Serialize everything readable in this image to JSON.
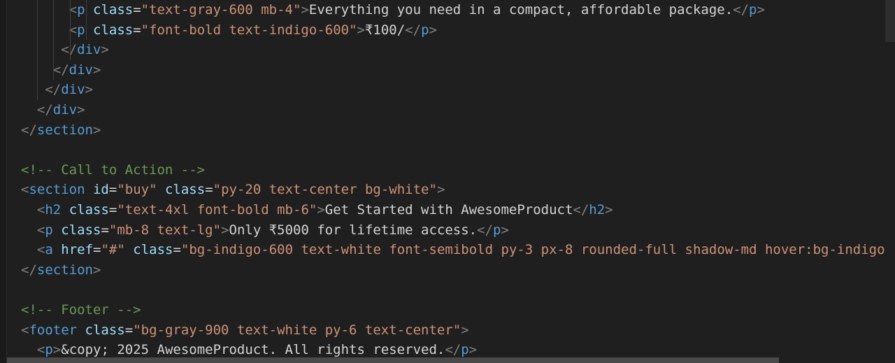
{
  "editor": {
    "theme_background": "#1f1f1f",
    "colors": {
      "punctuation": "#808080",
      "tag": "#569cd6",
      "attribute": "#9cdcfe",
      "string": "#ce9178",
      "text": "#d4d4d4",
      "comment": "#6a9955"
    },
    "lines": [
      {
        "guides": 4,
        "tokens": [
          {
            "t": "p",
            "v": "      "
          },
          {
            "t": "p",
            "v": "<"
          },
          {
            "t": "t",
            "v": "p"
          },
          {
            "t": "x",
            "v": " "
          },
          {
            "t": "a",
            "v": "class"
          },
          {
            "t": "x",
            "v": "="
          },
          {
            "t": "s",
            "v": "\"text-gray-600 mb-4\""
          },
          {
            "t": "p",
            "v": ">"
          },
          {
            "t": "x",
            "v": "Everything you need in a compact, affordable package."
          },
          {
            "t": "p",
            "v": "</"
          },
          {
            "t": "t",
            "v": "p"
          },
          {
            "t": "p",
            "v": ">"
          }
        ]
      },
      {
        "guides": 4,
        "tokens": [
          {
            "t": "p",
            "v": "      "
          },
          {
            "t": "p",
            "v": "<"
          },
          {
            "t": "t",
            "v": "p"
          },
          {
            "t": "x",
            "v": " "
          },
          {
            "t": "a",
            "v": "class"
          },
          {
            "t": "x",
            "v": "="
          },
          {
            "t": "s",
            "v": "\"font-bold text-indigo-600\""
          },
          {
            "t": "p",
            "v": ">"
          },
          {
            "t": "x",
            "v": "₹100/"
          },
          {
            "t": "p",
            "v": "</"
          },
          {
            "t": "t",
            "v": "p"
          },
          {
            "t": "p",
            "v": ">"
          }
        ]
      },
      {
        "guides": 3,
        "tokens": [
          {
            "t": "p",
            "v": "     "
          },
          {
            "t": "p",
            "v": "</"
          },
          {
            "t": "t",
            "v": "div"
          },
          {
            "t": "p",
            "v": ">"
          }
        ]
      },
      {
        "guides": 2,
        "tokens": [
          {
            "t": "p",
            "v": "    "
          },
          {
            "t": "p",
            "v": "</"
          },
          {
            "t": "t",
            "v": "div"
          },
          {
            "t": "p",
            "v": ">"
          }
        ]
      },
      {
        "guides": 1,
        "tokens": [
          {
            "t": "p",
            "v": "   "
          },
          {
            "t": "p",
            "v": "</"
          },
          {
            "t": "t",
            "v": "div"
          },
          {
            "t": "p",
            "v": ">"
          }
        ]
      },
      {
        "guides": 0,
        "tokens": [
          {
            "t": "p",
            "v": "  "
          },
          {
            "t": "p",
            "v": "</"
          },
          {
            "t": "t",
            "v": "div"
          },
          {
            "t": "p",
            "v": ">"
          }
        ]
      },
      {
        "guides": 0,
        "tokens": [
          {
            "t": "p",
            "v": "</"
          },
          {
            "t": "t",
            "v": "section"
          },
          {
            "t": "p",
            "v": ">"
          }
        ]
      },
      {
        "guides": 0,
        "tokens": []
      },
      {
        "guides": 0,
        "tokens": [
          {
            "t": "c",
            "v": "<!-- Call to Action -->"
          }
        ]
      },
      {
        "guides": 0,
        "tokens": [
          {
            "t": "p",
            "v": "<"
          },
          {
            "t": "t",
            "v": "section"
          },
          {
            "t": "x",
            "v": " "
          },
          {
            "t": "a",
            "v": "id"
          },
          {
            "t": "x",
            "v": "="
          },
          {
            "t": "s",
            "v": "\"buy\""
          },
          {
            "t": "x",
            "v": " "
          },
          {
            "t": "a",
            "v": "class"
          },
          {
            "t": "x",
            "v": "="
          },
          {
            "t": "s",
            "v": "\"py-20 text-center bg-white\""
          },
          {
            "t": "p",
            "v": ">"
          }
        ]
      },
      {
        "guides": 0,
        "tokens": [
          {
            "t": "p",
            "v": "  "
          },
          {
            "t": "p",
            "v": "<"
          },
          {
            "t": "t",
            "v": "h2"
          },
          {
            "t": "x",
            "v": " "
          },
          {
            "t": "a",
            "v": "class"
          },
          {
            "t": "x",
            "v": "="
          },
          {
            "t": "s",
            "v": "\"text-4xl font-bold mb-6\""
          },
          {
            "t": "p",
            "v": ">"
          },
          {
            "t": "x",
            "v": "Get Started with AwesomeProduct"
          },
          {
            "t": "p",
            "v": "</"
          },
          {
            "t": "t",
            "v": "h2"
          },
          {
            "t": "p",
            "v": ">"
          }
        ]
      },
      {
        "guides": 0,
        "tokens": [
          {
            "t": "p",
            "v": "  "
          },
          {
            "t": "p",
            "v": "<"
          },
          {
            "t": "t",
            "v": "p"
          },
          {
            "t": "x",
            "v": " "
          },
          {
            "t": "a",
            "v": "class"
          },
          {
            "t": "x",
            "v": "="
          },
          {
            "t": "s",
            "v": "\"mb-8 text-lg\""
          },
          {
            "t": "p",
            "v": ">"
          },
          {
            "t": "x",
            "v": "Only ₹5000 for lifetime access."
          },
          {
            "t": "p",
            "v": "</"
          },
          {
            "t": "t",
            "v": "p"
          },
          {
            "t": "p",
            "v": ">"
          }
        ]
      },
      {
        "guides": 0,
        "tokens": [
          {
            "t": "p",
            "v": "  "
          },
          {
            "t": "p",
            "v": "<"
          },
          {
            "t": "t",
            "v": "a"
          },
          {
            "t": "x",
            "v": " "
          },
          {
            "t": "a",
            "v": "href"
          },
          {
            "t": "x",
            "v": "="
          },
          {
            "t": "s",
            "v": "\"#\""
          },
          {
            "t": "x",
            "v": " "
          },
          {
            "t": "a",
            "v": "class"
          },
          {
            "t": "x",
            "v": "="
          },
          {
            "t": "s",
            "v": "\"bg-indigo-600 text-white font-semibold py-3 px-8 rounded-full shadow-md hover:bg-indigo"
          }
        ]
      },
      {
        "guides": 0,
        "tokens": [
          {
            "t": "p",
            "v": "</"
          },
          {
            "t": "t",
            "v": "section"
          },
          {
            "t": "p",
            "v": ">"
          }
        ]
      },
      {
        "guides": 0,
        "tokens": []
      },
      {
        "guides": 0,
        "tokens": [
          {
            "t": "c",
            "v": "<!-- Footer -->"
          }
        ]
      },
      {
        "guides": 0,
        "tokens": [
          {
            "t": "p",
            "v": "<"
          },
          {
            "t": "t",
            "v": "footer"
          },
          {
            "t": "x",
            "v": " "
          },
          {
            "t": "a",
            "v": "class"
          },
          {
            "t": "x",
            "v": "="
          },
          {
            "t": "s",
            "v": "\"bg-gray-900 text-white py-6 text-center\""
          },
          {
            "t": "p",
            "v": ">"
          }
        ]
      },
      {
        "guides": 0,
        "tokens": [
          {
            "t": "p",
            "v": "  "
          },
          {
            "t": "p",
            "v": "<"
          },
          {
            "t": "t",
            "v": "p"
          },
          {
            "t": "p",
            "v": ">"
          },
          {
            "t": "x",
            "v": "&copy; 2025 AwesomeProduct. All rights reserved."
          },
          {
            "t": "p",
            "v": "</"
          },
          {
            "t": "t",
            "v": "p"
          },
          {
            "t": "p",
            "v": ">"
          }
        ]
      }
    ]
  }
}
